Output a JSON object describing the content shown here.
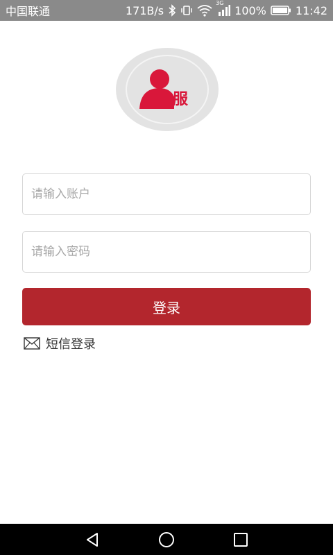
{
  "status_bar": {
    "carrier": "中国联通",
    "speed": "171B/s",
    "network_badge": "3G",
    "battery": "100%",
    "time": "11:42",
    "icons": [
      "bluetooth-icon",
      "vibrate-icon",
      "wifi-icon",
      "signal-icon",
      "battery-icon"
    ]
  },
  "logo": {
    "badge_char": "服",
    "accent_color": "#d9173a"
  },
  "form": {
    "account_placeholder": "请输入账户",
    "password_placeholder": "请输入密码",
    "login_label": "登录",
    "login_color": "#b3262d"
  },
  "sms_login": {
    "icon": "envelope-icon",
    "label": "短信登录"
  },
  "nav_bar": {
    "icons": [
      "back-icon",
      "home-icon",
      "recents-icon"
    ]
  }
}
